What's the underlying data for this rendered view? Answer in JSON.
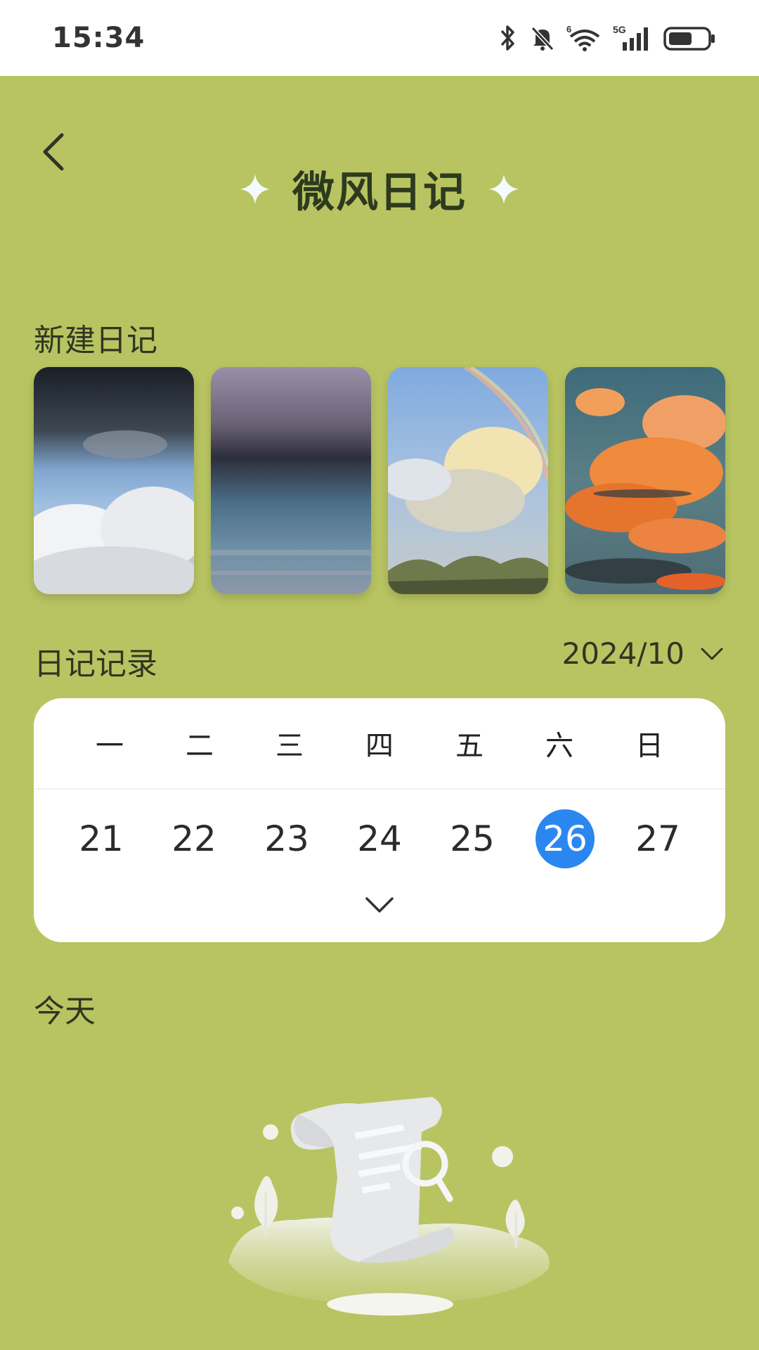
{
  "status_bar": {
    "time": "15:34",
    "icons": [
      "bluetooth-icon",
      "bell-muted-icon",
      "wifi-6-icon",
      "signal-5g-icon",
      "battery-icon"
    ],
    "wifi_badge": "6",
    "network_badge": "5G"
  },
  "header": {
    "title": "微风日记",
    "back_icon": "chevron-left-icon"
  },
  "new_diary": {
    "label": "新建日记",
    "backgrounds": [
      {
        "name": "stormy-sky"
      },
      {
        "name": "misty-blue"
      },
      {
        "name": "rainbow-clouds"
      },
      {
        "name": "sunset-clouds"
      }
    ]
  },
  "diary_records": {
    "label": "日记记录",
    "month": "2024/10",
    "calendar": {
      "weekdays": [
        "一",
        "二",
        "三",
        "四",
        "五",
        "六",
        "日"
      ],
      "days": [
        "21",
        "22",
        "23",
        "24",
        "25",
        "26",
        "27"
      ],
      "selected_day": "26",
      "accent_color": "#2b87f0"
    }
  },
  "today": {
    "label": "今天"
  },
  "theme": {
    "background": "#b8c461",
    "card": "#ffffff"
  }
}
